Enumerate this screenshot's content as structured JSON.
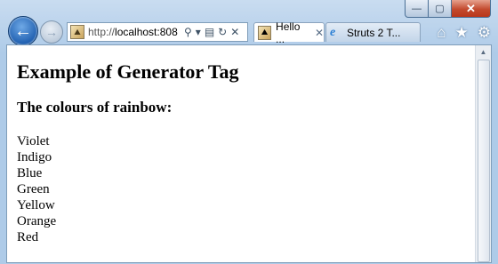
{
  "window": {
    "minimize_glyph": "—",
    "maximize_glyph": "▢",
    "close_glyph": "✕"
  },
  "nav": {
    "back_glyph": "←",
    "forward_glyph": "→"
  },
  "address_bar": {
    "url_prefix": "http://",
    "url_host": "localhost:808",
    "search_glyph": "⚲",
    "dropdown_glyph": "▾",
    "compat_glyph": "▤",
    "refresh_glyph": "↻",
    "stop_glyph": "✕"
  },
  "tabs": [
    {
      "title": "Hello ...",
      "icon": "page-favicon",
      "close_glyph": "✕",
      "active": true
    },
    {
      "title": "Struts 2 T...",
      "icon": "ie-favicon",
      "active": false
    }
  ],
  "toolbar": {
    "home_glyph": "⌂",
    "favorites_glyph": "★",
    "tools_glyph": "⚙"
  },
  "page": {
    "heading": "Example of Generator Tag",
    "subheading": "The colours of rainbow:",
    "colours": [
      "Violet",
      "Indigo",
      "Blue",
      "Green",
      "Yellow",
      "Orange",
      "Red"
    ]
  },
  "colors": {
    "chrome_bg": "#aecbe8",
    "close_red": "#c34a2e",
    "back_blue": "#1f5fb0"
  }
}
